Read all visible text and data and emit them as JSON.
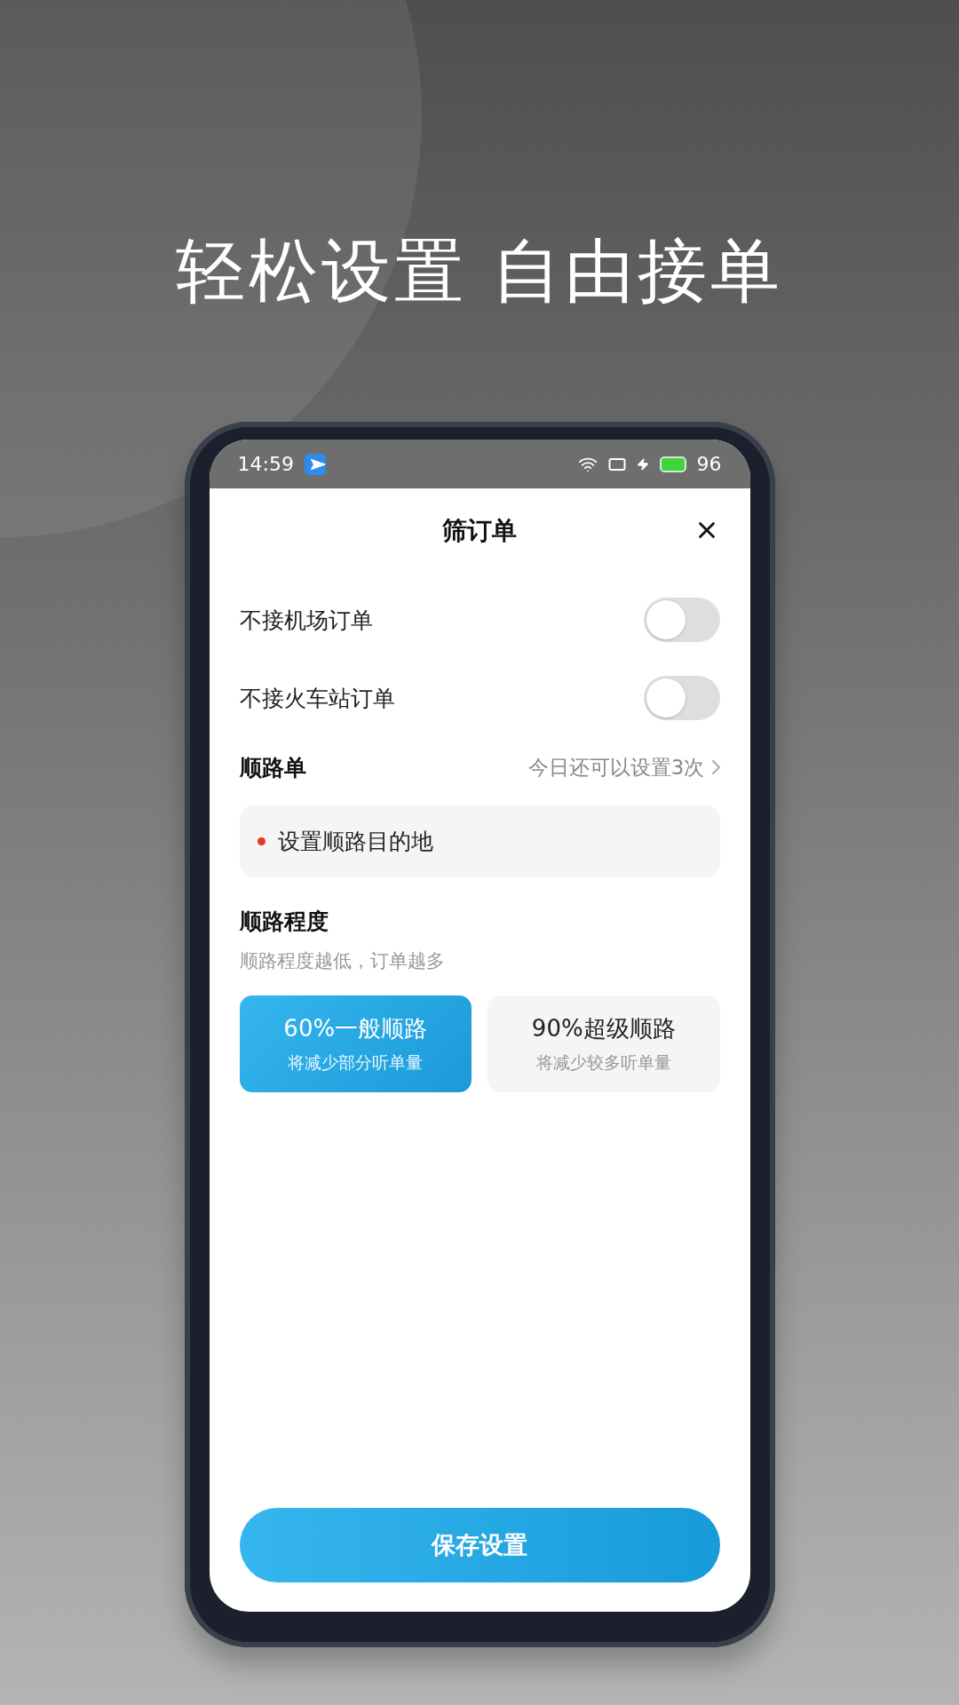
{
  "headline": "轻松设置 自由接单",
  "status_bar": {
    "time": "14:59",
    "battery": "96"
  },
  "sheet": {
    "title": "筛订单",
    "toggles": [
      {
        "label": "不接机场订单",
        "on": false
      },
      {
        "label": "不接火车站订单",
        "on": false
      }
    ],
    "route": {
      "label": "顺路单",
      "hint": "今日还可以设置3次",
      "destination": "设置顺路目的地"
    },
    "degree": {
      "title": "顺路程度",
      "subtitle": "顺路程度越低，订单越多",
      "options": [
        {
          "title": "60%一般顺路",
          "note": "将减少部分听单量",
          "selected": true
        },
        {
          "title": "90%超级顺路",
          "note": "将减少较多听单量",
          "selected": false
        }
      ]
    },
    "save_button": "保存设置"
  }
}
